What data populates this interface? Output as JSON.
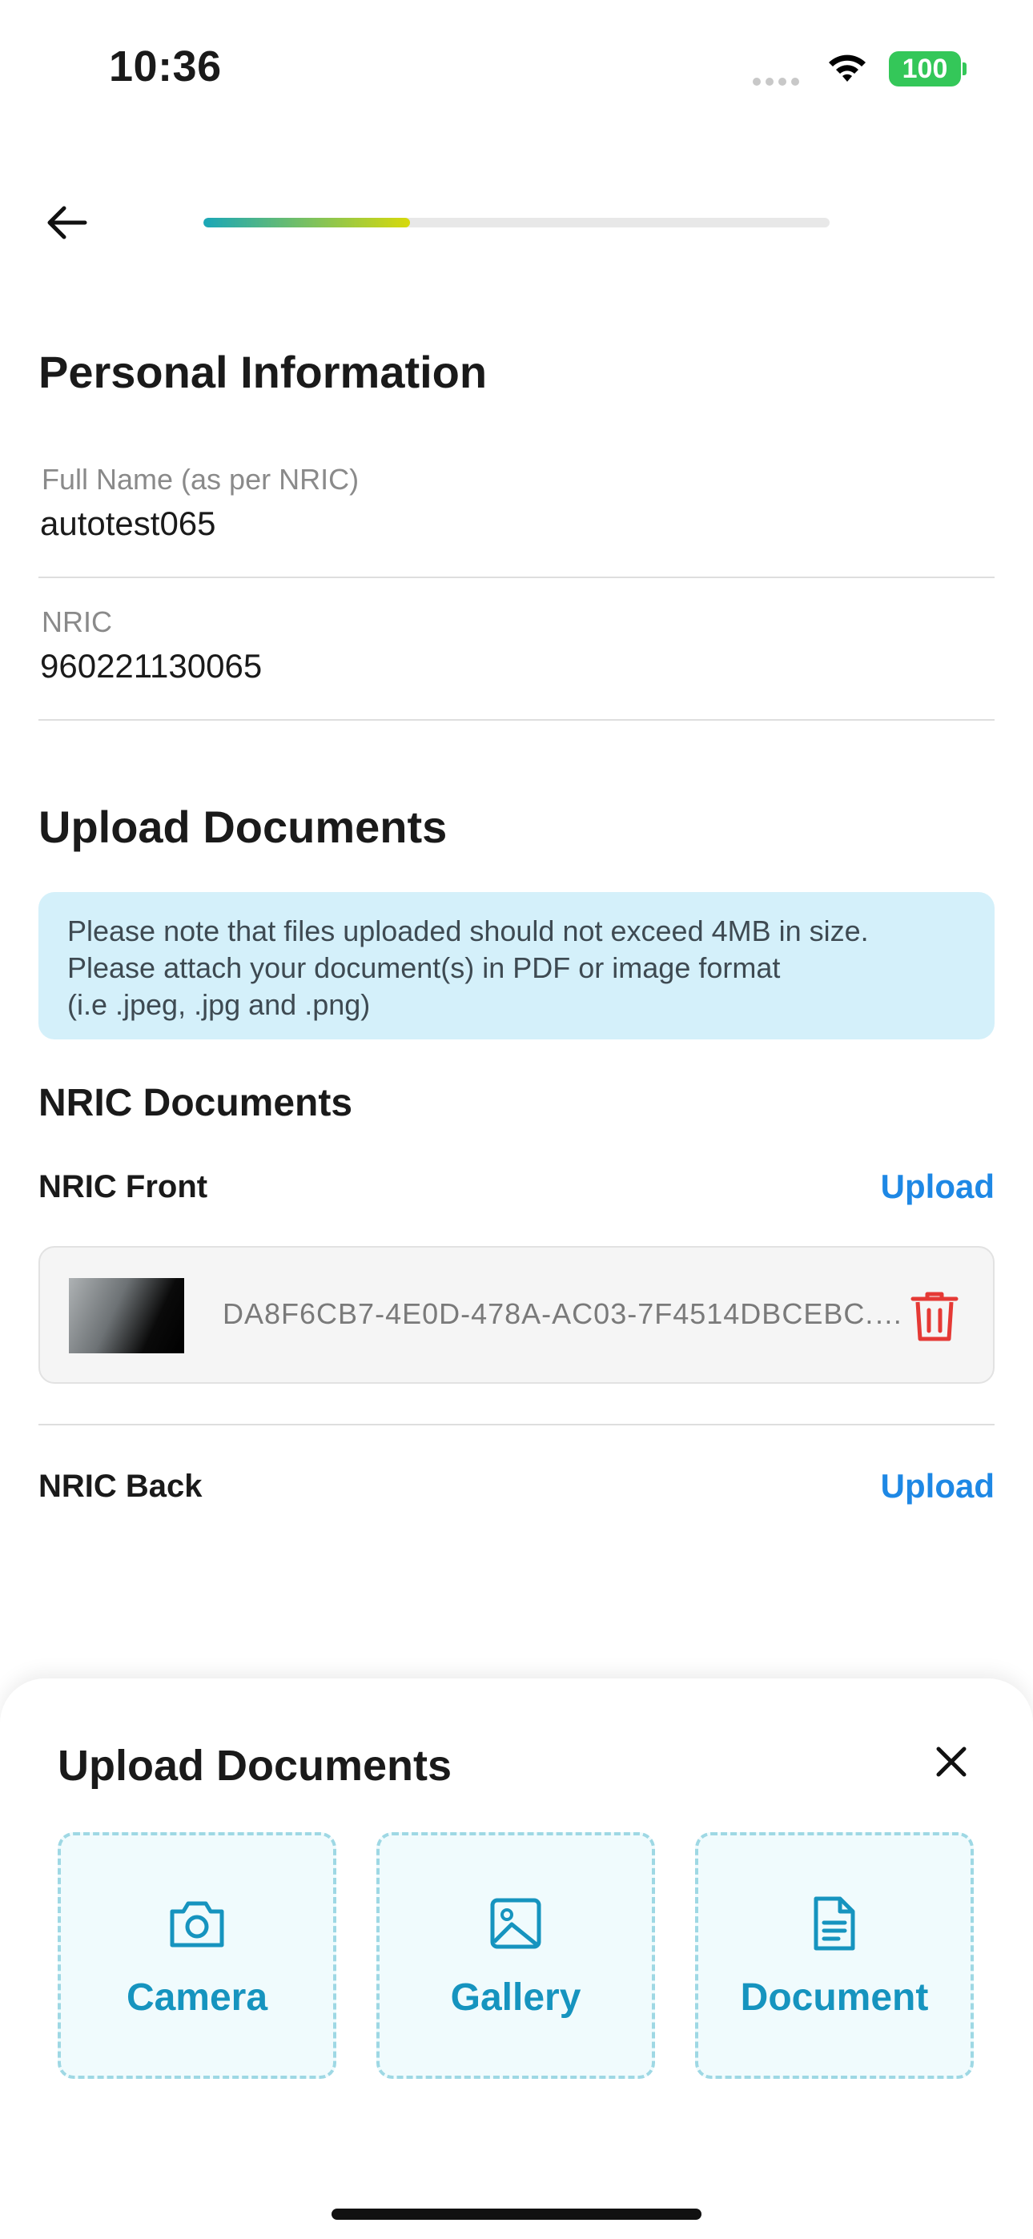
{
  "status_bar": {
    "time": "10:36",
    "battery": "100"
  },
  "header": {
    "progress_fraction": 0.33
  },
  "personal": {
    "title": "Personal Information",
    "full_name_label": "Full Name (as per NRIC)",
    "full_name_value": "autotest065",
    "nric_label": "NRIC",
    "nric_value": "960221130065"
  },
  "upload": {
    "title": "Upload Documents",
    "note_line1": "Please note that files uploaded should not exceed 4MB in size.",
    "note_line2": "Please attach your document(s) in PDF or image format",
    "note_line3": "(i.e .jpeg, .jpg and .png)",
    "section_title": "NRIC Documents",
    "front_label": "NRIC Front",
    "front_upload": "Upload",
    "front_file_name": "DA8F6CB7-4E0D-478A-AC03-7F4514DBCEBC.jpg",
    "back_label": "NRIC Back",
    "back_upload": "Upload"
  },
  "sheet": {
    "title": "Upload Documents",
    "options": [
      {
        "label": "Camera",
        "icon": "camera-icon"
      },
      {
        "label": "Gallery",
        "icon": "image-icon"
      },
      {
        "label": "Document",
        "icon": "document-icon"
      }
    ]
  },
  "colors": {
    "accent": "#1e88e5",
    "option": "#1694bf",
    "danger": "#e53935",
    "note_bg": "#d4f0fa"
  }
}
